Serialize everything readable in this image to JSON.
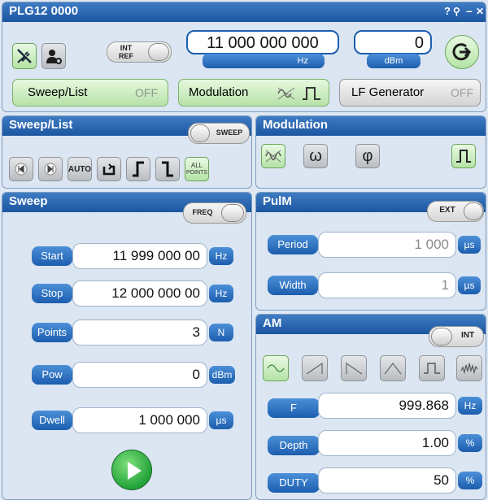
{
  "window": {
    "title": "PLG12 0000",
    "help_glyph": "?",
    "pin_glyph": "⚲",
    "minimize_glyph": "–",
    "close_glyph": "✕"
  },
  "top": {
    "int_ref_line1": "INT",
    "int_ref_line2": "REF",
    "frequency_value": "11 000 000 000",
    "frequency_unit": "Hz",
    "power_value": "0",
    "power_unit": "dBm"
  },
  "mode_buttons": {
    "sweep_list_label": "Sweep/List",
    "sweep_list_state": "OFF",
    "modulation_label": "Modulation",
    "lf_generator_label": "LF Generator",
    "lf_generator_state": "OFF"
  },
  "sweep_list_panel": {
    "title": "Sweep/List",
    "toggle_label": "SWEEP",
    "auto_label": "AUTO",
    "all_points_line1": "ALL",
    "all_points_line2": "POINTS"
  },
  "modulation_panel": {
    "title": "Modulation",
    "omega_glyph": "ω",
    "phi_glyph": "φ"
  },
  "sweep_panel": {
    "title": "Sweep",
    "toggle_label": "FREQ",
    "rows": [
      {
        "label": "Start",
        "value": "11 999 000 00",
        "unit": "Hz"
      },
      {
        "label": "Stop",
        "value": "12 000 000 00",
        "unit": "Hz"
      },
      {
        "label": "Points",
        "value": "3",
        "unit": "N"
      },
      {
        "label": "Pow",
        "value": "0",
        "unit": "dBm"
      },
      {
        "label": "Dwell",
        "value": "1 000 000",
        "unit": "µs"
      }
    ]
  },
  "pulm_panel": {
    "title": "PulM",
    "toggle_label": "EXT",
    "rows": [
      {
        "label": "Period",
        "value": "1 000",
        "unit": "µs"
      },
      {
        "label": "Width",
        "value": "1",
        "unit": "µs"
      }
    ]
  },
  "am_panel": {
    "title": "AM",
    "toggle_label": "INT",
    "rows": [
      {
        "label": "F",
        "value": "999.868",
        "unit": "Hz"
      },
      {
        "label": "Depth",
        "value": "1.00",
        "unit": "%"
      },
      {
        "label": "DUTY",
        "value": "50",
        "unit": "%"
      }
    ]
  },
  "colors": {
    "header_blue": "#1b56a0",
    "accent_green": "#5cb85c",
    "label_blue": "#1c5eae",
    "panel_bg": "#dbe6f2"
  }
}
